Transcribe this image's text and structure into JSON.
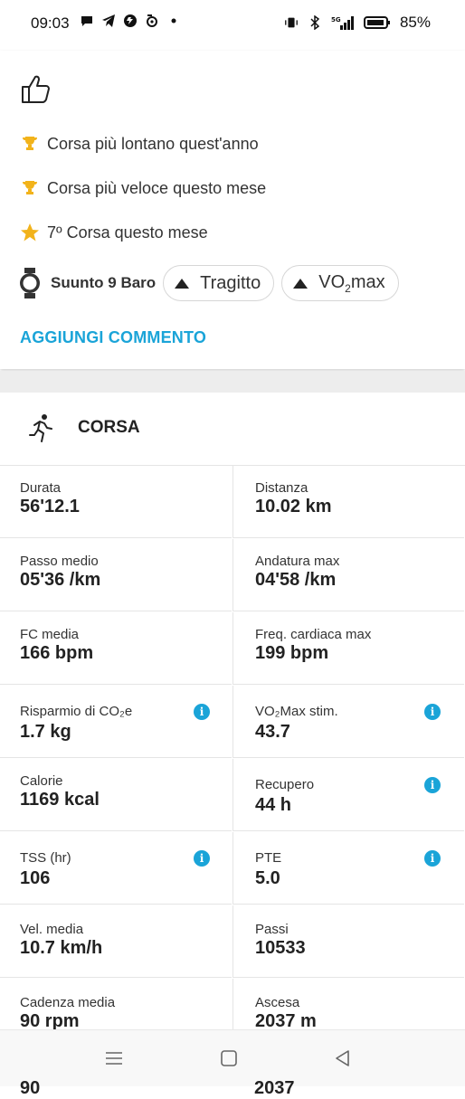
{
  "status_bar": {
    "time": "09:03",
    "battery_percent": "85%",
    "network": "5G",
    "left_icons": [
      "chat-icon",
      "telegram-icon",
      "shazam-icon",
      "app-icon",
      "dot-icon"
    ],
    "right_icons": [
      "vibrate-icon",
      "bluetooth-icon",
      "signal-icon",
      "battery-icon"
    ]
  },
  "achievements": [
    {
      "icon": "trophy-icon",
      "color": "#f2b31b",
      "text": "Corsa più lontano quest'anno"
    },
    {
      "icon": "trophy-icon",
      "color": "#f2b31b",
      "text": "Corsa più veloce questo mese"
    },
    {
      "icon": "star-icon",
      "color": "#f2b31b",
      "text": "7º Corsa questo mese"
    }
  ],
  "device": {
    "name": "Suunto 9 Baro",
    "chips": [
      {
        "label": "Tragitto"
      },
      {
        "label_prefix": "VO",
        "label_sub": "2",
        "label_suffix": "max"
      }
    ]
  },
  "comment_link": "AGGIUNGI COMMENTO",
  "activity": {
    "title": "CORSA",
    "stats": [
      {
        "label": "Durata",
        "value": "56'12.1",
        "info": false
      },
      {
        "label": "Distanza",
        "value": "10.02 km",
        "info": false
      },
      {
        "label": "Passo medio",
        "value": "05'36 /km",
        "info": false
      },
      {
        "label": "Andatura max",
        "value": "04'58 /km",
        "info": false
      },
      {
        "label": "FC media",
        "value": "166 bpm",
        "info": false
      },
      {
        "label": "Freq. cardiaca max",
        "value": "199 bpm",
        "info": false
      },
      {
        "label": "Risparmio di CO₂e",
        "value": "1.7 kg",
        "info": true
      },
      {
        "label": "VO₂Max stim.",
        "value": "43.7",
        "info": true
      },
      {
        "label": "Calorie",
        "value": "1169 kcal",
        "info": false
      },
      {
        "label": "Recupero",
        "value": "44 h",
        "info": true
      },
      {
        "label": "TSS (hr)",
        "value": "106",
        "info": true
      },
      {
        "label": "PTE",
        "value": "5.0",
        "info": true
      },
      {
        "label": "Vel. media",
        "value": "10.7 km/h",
        "info": false
      },
      {
        "label": "Passi",
        "value": "10533",
        "info": false
      },
      {
        "label": "Cadenza media",
        "value": "90 rpm",
        "info": false
      },
      {
        "label": "Ascesa",
        "value": "2037 m",
        "info": false
      }
    ],
    "partial_row": [
      "90",
      "2037"
    ]
  },
  "nav_bar": {
    "buttons": [
      "menu-icon",
      "home-icon",
      "back-icon"
    ]
  },
  "colors": {
    "accent": "#1aa4d8",
    "trophy": "#f2b31b"
  }
}
